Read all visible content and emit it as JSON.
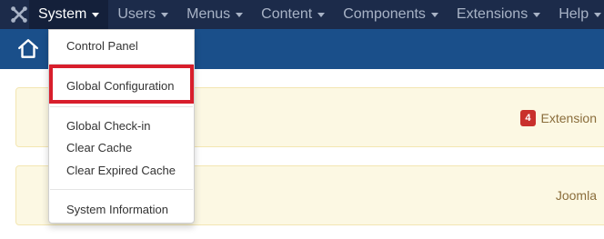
{
  "navbar": {
    "items": [
      {
        "label": "System"
      },
      {
        "label": "Users"
      },
      {
        "label": "Menus"
      },
      {
        "label": "Content"
      },
      {
        "label": "Components"
      },
      {
        "label": "Extensions"
      },
      {
        "label": "Help"
      }
    ]
  },
  "system_menu": {
    "items": [
      {
        "label": "Control Panel"
      },
      {
        "label": "Global Configuration"
      },
      {
        "label": "Global Check-in"
      },
      {
        "label": "Clear Cache"
      },
      {
        "label": "Clear Expired Cache"
      },
      {
        "label": "System Information"
      }
    ]
  },
  "panels": {
    "extensions_badge": "4",
    "extensions_text": "Extension",
    "joomla_text": "Joomla"
  },
  "colors": {
    "navbar": "#1c2b4a",
    "subheader": "#1a4f8a",
    "highlight": "#d81e2c",
    "panel_bg": "#fcf8e3",
    "badge": "#c9302c"
  },
  "icons": {
    "logo": "joomla-logo-icon",
    "home": "home-icon"
  }
}
